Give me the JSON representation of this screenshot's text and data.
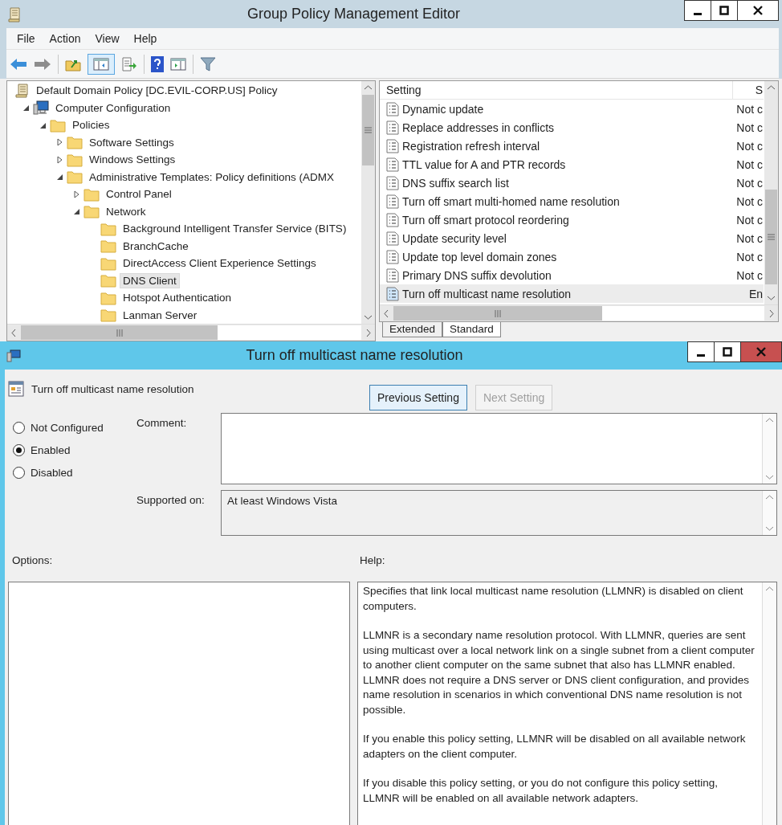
{
  "window": {
    "title": "Group Policy Management Editor"
  },
  "menu": [
    "File",
    "Action",
    "View",
    "Help"
  ],
  "tree": {
    "items": [
      {
        "label": "Default Domain Policy [DC.EVIL-CORP.US] Policy",
        "kind": "policy",
        "selected": false,
        "children": [
          {
            "label": "Computer Configuration",
            "kind": "computer",
            "selected": false,
            "expanded": true,
            "children": [
              {
                "label": "Policies",
                "kind": "folder",
                "selected": false,
                "expanded": true,
                "children": [
                  {
                    "label": "Software Settings",
                    "kind": "folder",
                    "selected": false,
                    "expanded": false
                  },
                  {
                    "label": "Windows Settings",
                    "kind": "folder",
                    "selected": false,
                    "expanded": false
                  },
                  {
                    "label": "Administrative Templates: Policy definitions (ADMX",
                    "kind": "folder",
                    "selected": false,
                    "expanded": true,
                    "children": [
                      {
                        "label": "Control Panel",
                        "kind": "folder",
                        "selected": false,
                        "expanded": false
                      },
                      {
                        "label": "Network",
                        "kind": "folder",
                        "selected": false,
                        "expanded": true,
                        "children": [
                          {
                            "label": "Background Intelligent Transfer Service (BITS)",
                            "kind": "folder",
                            "selected": false
                          },
                          {
                            "label": "BranchCache",
                            "kind": "folder",
                            "selected": false
                          },
                          {
                            "label": "DirectAccess Client Experience Settings",
                            "kind": "folder",
                            "selected": false
                          },
                          {
                            "label": "DNS Client",
                            "kind": "folder",
                            "selected": true
                          },
                          {
                            "label": "Hotspot Authentication",
                            "kind": "folder",
                            "selected": false
                          },
                          {
                            "label": "Lanman Server",
                            "kind": "folder",
                            "selected": false
                          }
                        ]
                      }
                    ]
                  }
                ]
              }
            ]
          }
        ]
      }
    ]
  },
  "settings": {
    "columns": [
      "Setting",
      "S"
    ],
    "rows": [
      {
        "setting": "Dynamic update",
        "state": "Not c",
        "selected": false
      },
      {
        "setting": "Replace addresses in conflicts",
        "state": "Not c",
        "selected": false
      },
      {
        "setting": "Registration refresh interval",
        "state": "Not c",
        "selected": false
      },
      {
        "setting": "TTL value for A and PTR records",
        "state": "Not c",
        "selected": false
      },
      {
        "setting": "DNS suffix search list",
        "state": "Not c",
        "selected": false
      },
      {
        "setting": "Turn off smart multi-homed name resolution",
        "state": "Not c",
        "selected": false
      },
      {
        "setting": "Turn off smart protocol reordering",
        "state": "Not c",
        "selected": false
      },
      {
        "setting": "Update security level",
        "state": "Not c",
        "selected": false
      },
      {
        "setting": "Update top level domain zones",
        "state": "Not c",
        "selected": false
      },
      {
        "setting": "Primary DNS suffix devolution",
        "state": "Not c",
        "selected": false
      },
      {
        "setting": "Turn off multicast name resolution",
        "state": "En",
        "selected": true
      }
    ]
  },
  "tabs": [
    {
      "label": "Extended",
      "selected": false
    },
    {
      "label": "Standard",
      "selected": true
    }
  ],
  "dialog": {
    "title": "Turn off multicast name resolution",
    "setting_name": "Turn off multicast name resolution",
    "buttons": [
      {
        "label": "Previous Setting",
        "disabled": false
      },
      {
        "label": "Next Setting",
        "disabled": true
      }
    ],
    "radios": [
      {
        "label": "Not Configured",
        "selected": false
      },
      {
        "label": "Enabled",
        "selected": true
      },
      {
        "label": "Disabled",
        "selected": false
      }
    ],
    "comment": {
      "label": "Comment:"
    },
    "supported_on": {
      "label": "Supported on:",
      "value": "At least Windows Vista"
    },
    "options_label": "Options:",
    "help_label": "Help:",
    "help_paragraphs": [
      "Specifies that link local multicast name resolution (LLMNR) is disabled on client computers.",
      "LLMNR is a secondary name resolution protocol. With LLMNR, queries are sent using multicast over a local network link on a single subnet from a client computer to another client computer on the same subnet that also has LLMNR enabled. LLMNR does not require a DNS server or DNS client configuration, and provides name resolution in scenarios in which conventional DNS name resolution is not possible.",
      "If you enable this policy setting, LLMNR will be disabled on all available network adapters on the client computer.",
      "If you disable this policy setting, or you do not configure this policy setting, LLMNR will be enabled on all available network adapters."
    ]
  }
}
